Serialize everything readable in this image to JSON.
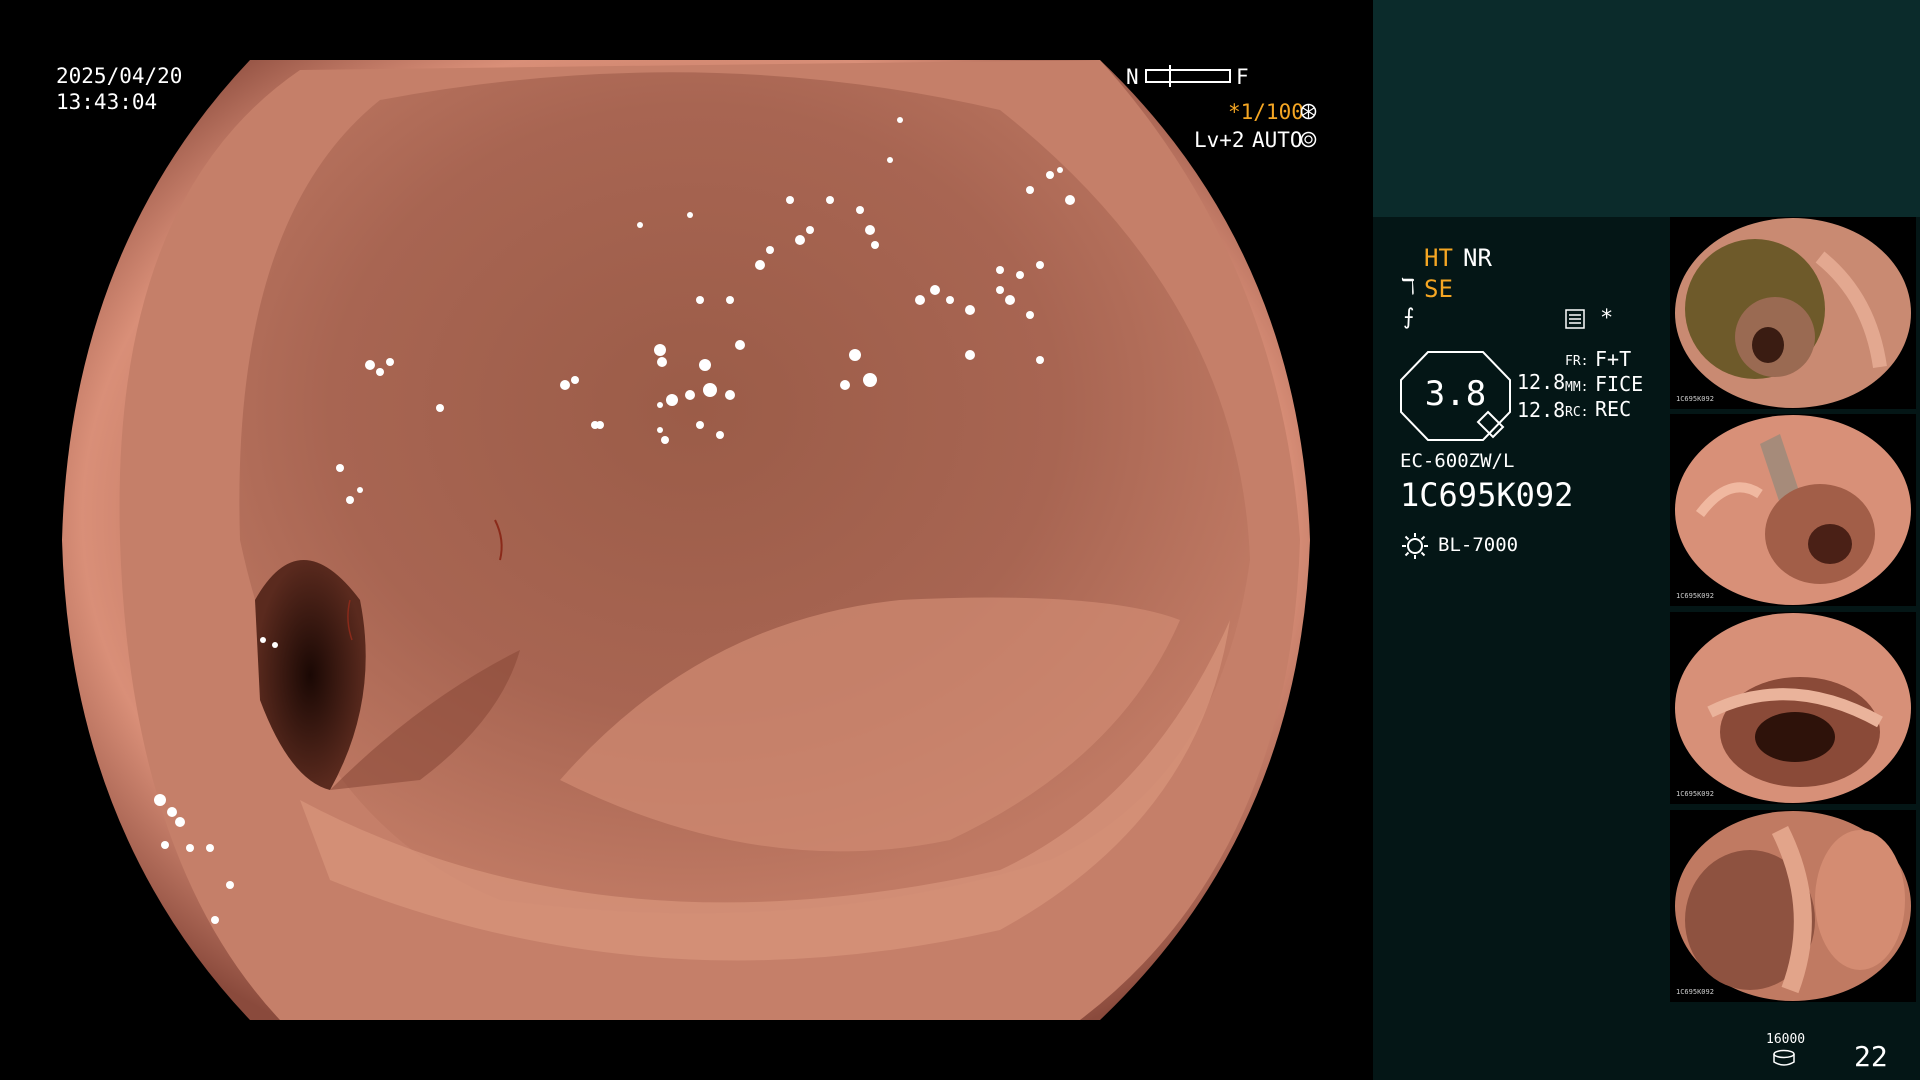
{
  "overlay": {
    "date": "2025/04/20",
    "time": "13:43:04",
    "focus_n": "N",
    "focus_f": "F",
    "shutter": "*1/100",
    "shutter_icon": "aperture-icon",
    "level": "Lv+2",
    "iris": "AUTO",
    "iris_icon": "iris-icon"
  },
  "panel": {
    "ht": "HT",
    "nr": "NR",
    "se": "SE",
    "se_prefix": "ℸ",
    "f_icon": "⨍",
    "star": "*",
    "zoom_value": "3.8",
    "val1": "12.8",
    "val2": "12.8",
    "fr_label": "FR:",
    "fr_value": "F+T",
    "mm_label": "MM:",
    "mm_value": "FICE",
    "rc_label": "RC:",
    "rc_value": "REC",
    "scope_model": "EC-600ZW/L",
    "serial": "1C695K092",
    "light_source": "BL-7000",
    "disk_capacity": "16000",
    "image_count": "22"
  },
  "thumbnails": [
    {
      "name": "thumb-1",
      "label": "1C695K092"
    },
    {
      "name": "thumb-2",
      "label": "1C695K092"
    },
    {
      "name": "thumb-3",
      "label": "1C695K092"
    },
    {
      "name": "thumb-4",
      "label": "1C695K092"
    }
  ],
  "colors": {
    "mucosa": "#c9826c",
    "mucosa_dark": "#7a3a2c",
    "panel_bg": "#041616",
    "panel_top": "#0b2b2b",
    "accent_orange": "#f5a623"
  }
}
